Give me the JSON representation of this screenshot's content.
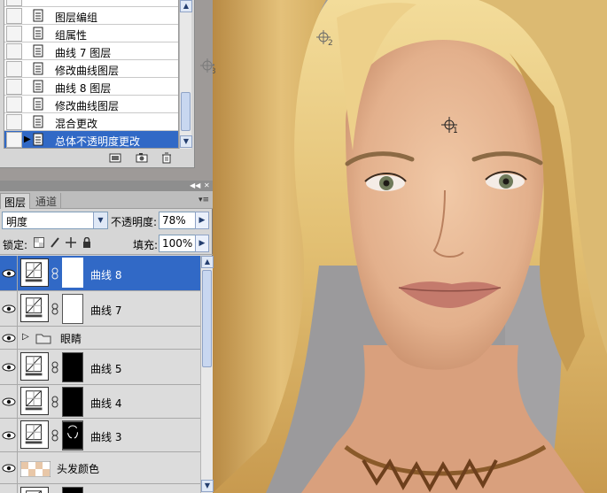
{
  "history": {
    "items": [
      {
        "label": "",
        "partial": true
      },
      {
        "label": "图层编组"
      },
      {
        "label": "组属性"
      },
      {
        "label": "曲线 7 图层"
      },
      {
        "label": "修改曲线图层"
      },
      {
        "label": "曲线 8 图层"
      },
      {
        "label": "修改曲线图层"
      },
      {
        "label": "混合更改"
      },
      {
        "label": "总体不透明度更改",
        "selected": true
      }
    ],
    "footer_icons": [
      "new-document-from-state-icon",
      "snapshot-camera-icon",
      "trash-icon"
    ]
  },
  "layers_panel": {
    "tabs": [
      "图层",
      "通道"
    ],
    "active_tab": "图层",
    "blend_mode": "明度",
    "opacity_label": "不透明度:",
    "opacity_value": "78%",
    "lock_label": "锁定:",
    "fill_label": "填充:",
    "fill_value": "100%",
    "layers": [
      {
        "name": "曲线 8",
        "type": "curves",
        "mask": "white",
        "selected": true
      },
      {
        "name": "曲线 7",
        "type": "curves",
        "mask": "white"
      },
      {
        "name": "眼睛",
        "type": "group"
      },
      {
        "name": "曲线 5",
        "type": "curves",
        "mask": "black"
      },
      {
        "name": "曲线 4",
        "type": "curves",
        "mask": "black"
      },
      {
        "name": "曲线 3",
        "type": "curves",
        "mask": "black-strokes"
      },
      {
        "name": "头发颜色",
        "type": "pixel"
      },
      {
        "name": "",
        "type": "curves",
        "mask": "black",
        "partial": true
      }
    ]
  },
  "canvas": {
    "sampler_points": [
      "1",
      "2",
      "3"
    ]
  },
  "colors": {
    "selection_blue": "#3169c6",
    "panel_gray": "#d6d6d6",
    "backdrop_gray": "#9c9b9d"
  }
}
